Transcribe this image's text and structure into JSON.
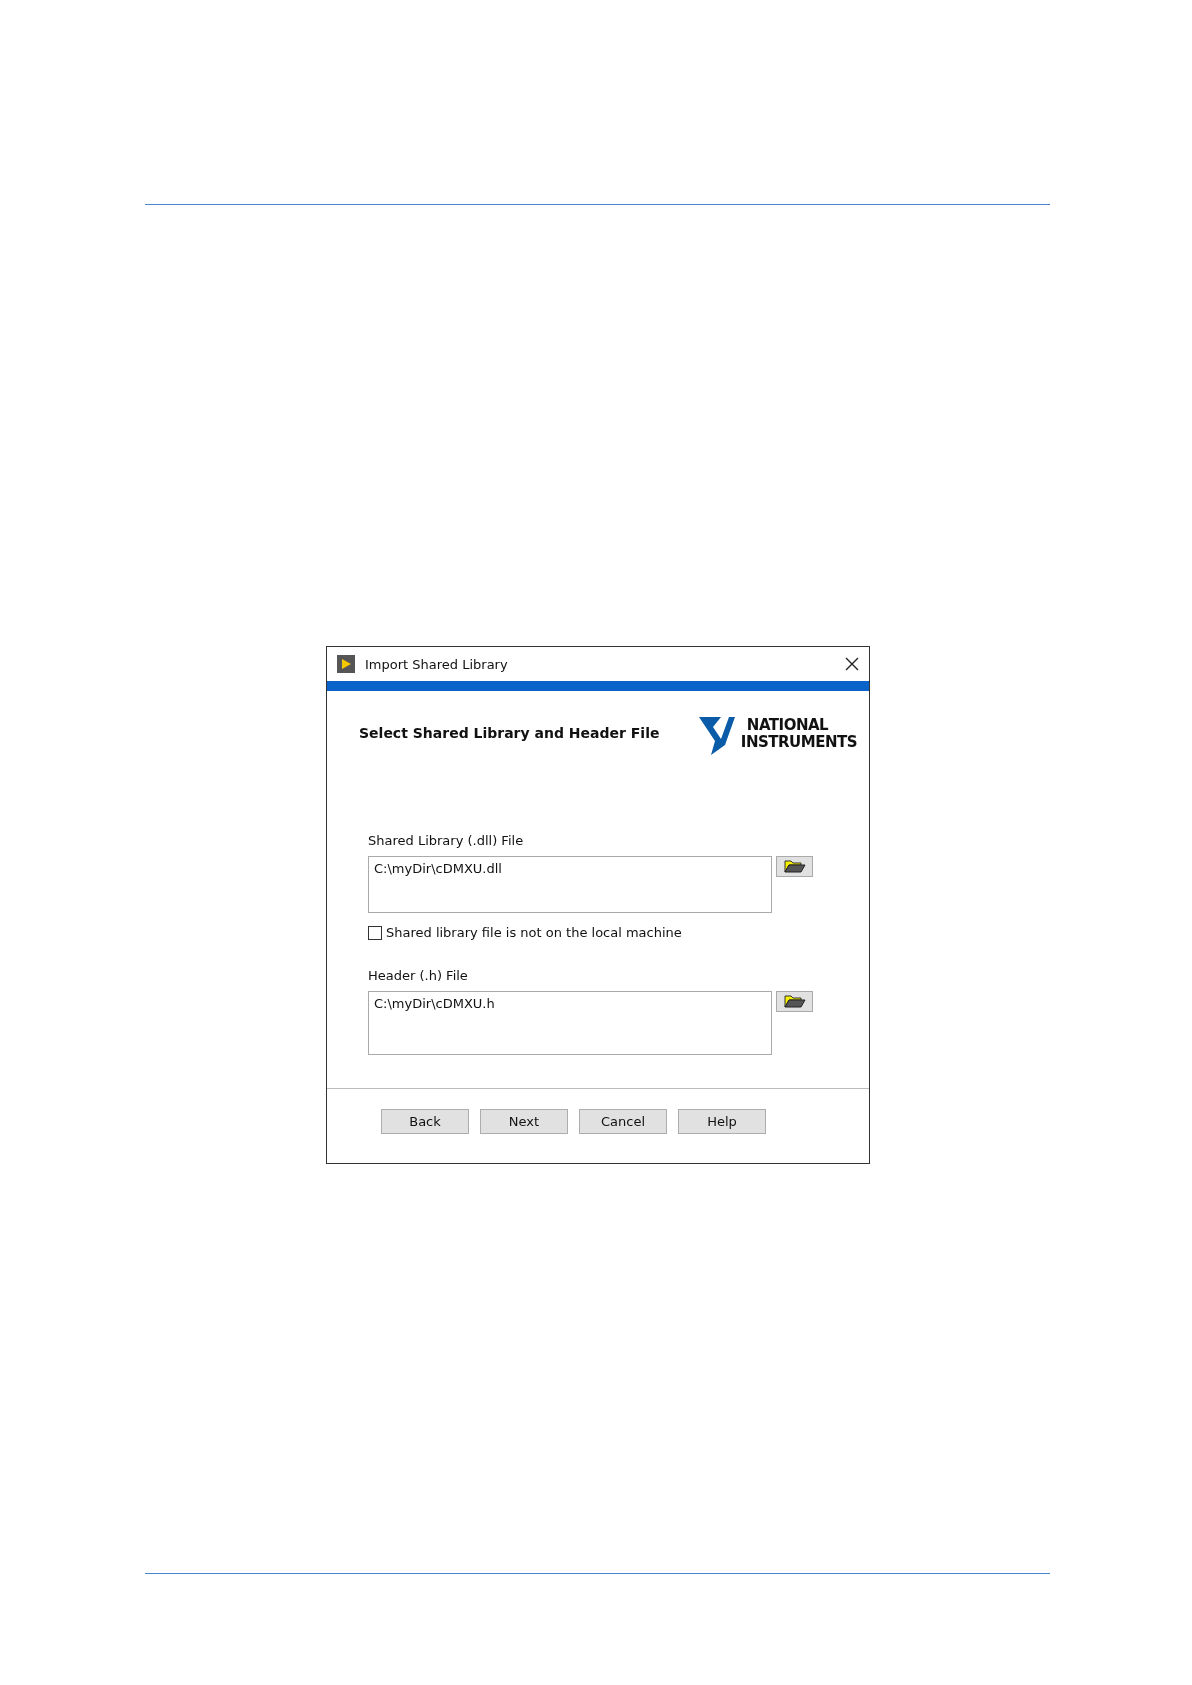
{
  "dialog": {
    "title": "Import Shared Library",
    "heading": "Select Shared Library and Header File",
    "logo": [
      "NATIONAL",
      "INSTRUMENTS"
    ],
    "library": {
      "label": "Shared Library (.dll) File",
      "value": "C:\\myDir\\cDMXU.dll"
    },
    "remote_checkbox": {
      "label": "Shared library file is not on the local machine",
      "checked": false
    },
    "header": {
      "label": "Header (.h) File",
      "value": "C:\\myDir\\cDMXU.h"
    },
    "buttons": [
      "Back",
      "Next",
      "Cancel",
      "Help"
    ]
  }
}
